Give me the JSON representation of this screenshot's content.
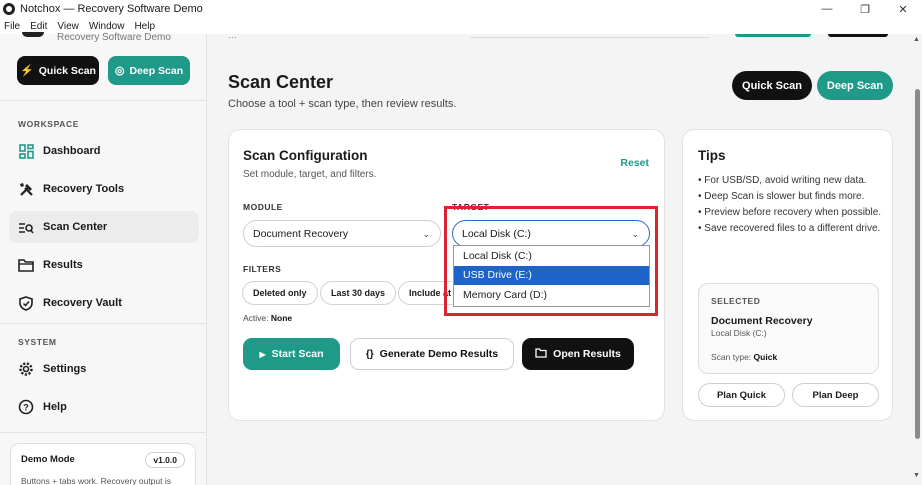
{
  "window": {
    "title": "Notchox — Recovery Software Demo",
    "minimize": "—",
    "maximize": "❐",
    "close": "✕"
  },
  "menu": [
    "File",
    "Edit",
    "View",
    "Window",
    "Help"
  ],
  "sidebar": {
    "brand_sub": "Recovery Software Demo",
    "quick_scan": "Quick Scan",
    "deep_scan": "Deep Scan",
    "section_workspace": "WORKSPACE",
    "section_system": "SYSTEM",
    "items": [
      {
        "label": "Dashboard",
        "icon": "dashboard-icon"
      },
      {
        "label": "Recovery Tools",
        "icon": "tools-icon"
      },
      {
        "label": "Scan Center",
        "icon": "scan-list-icon"
      },
      {
        "label": "Results",
        "icon": "folder-icon"
      },
      {
        "label": "Recovery Vault",
        "icon": "shield-icon"
      },
      {
        "label": "Settings",
        "icon": "gear-icon"
      },
      {
        "label": "Help",
        "icon": "help-icon"
      }
    ],
    "demo": {
      "title": "Demo Mode",
      "version": "v1.0.0",
      "desc": "Buttons + tabs work. Recovery output is"
    }
  },
  "header": {
    "top_text": "…",
    "title": "Scan Center",
    "subtitle": "Choose a tool + scan type, then review results.",
    "quick_scan": "Quick Scan",
    "deep_scan": "Deep Scan"
  },
  "config": {
    "title": "Scan Configuration",
    "subtitle": "Set module, target, and filters.",
    "reset": "Reset",
    "module_label": "MODULE",
    "module_value": "Document Recovery",
    "target_label": "TARGET",
    "target_value": "Local Disk (C:)",
    "filters_label": "FILTERS",
    "chips": [
      "Deleted only",
      "Last 30 days",
      "Include at"
    ],
    "active_label": "Active:",
    "active_value": "None",
    "start_scan": "Start Scan",
    "generate": "Generate Demo Results",
    "open_results": "Open Results",
    "target_options": [
      {
        "label": "Local Disk (C:)",
        "selected": false
      },
      {
        "label": "USB Drive (E:)",
        "selected": true
      },
      {
        "label": "Memory Card (D:)",
        "selected": false
      }
    ]
  },
  "tips": {
    "title": "Tips",
    "items": [
      "For USB/SD, avoid writing new data.",
      "Deep Scan is slower but finds more.",
      "Preview before recovery when possible.",
      "Save recovered files to a different drive."
    ],
    "selected_label": "SELECTED",
    "selected_name": "Document Recovery",
    "selected_target": "Local Disk (C:)",
    "scan_type_label": "Scan type:",
    "scan_type_value": "Quick",
    "plan_quick": "Plan Quick",
    "plan_deep": "Plan Deep"
  },
  "colors": {
    "accent": "#1f9988",
    "dark": "#111111",
    "highlight": "#d8262f",
    "selection": "#1e63c8"
  }
}
